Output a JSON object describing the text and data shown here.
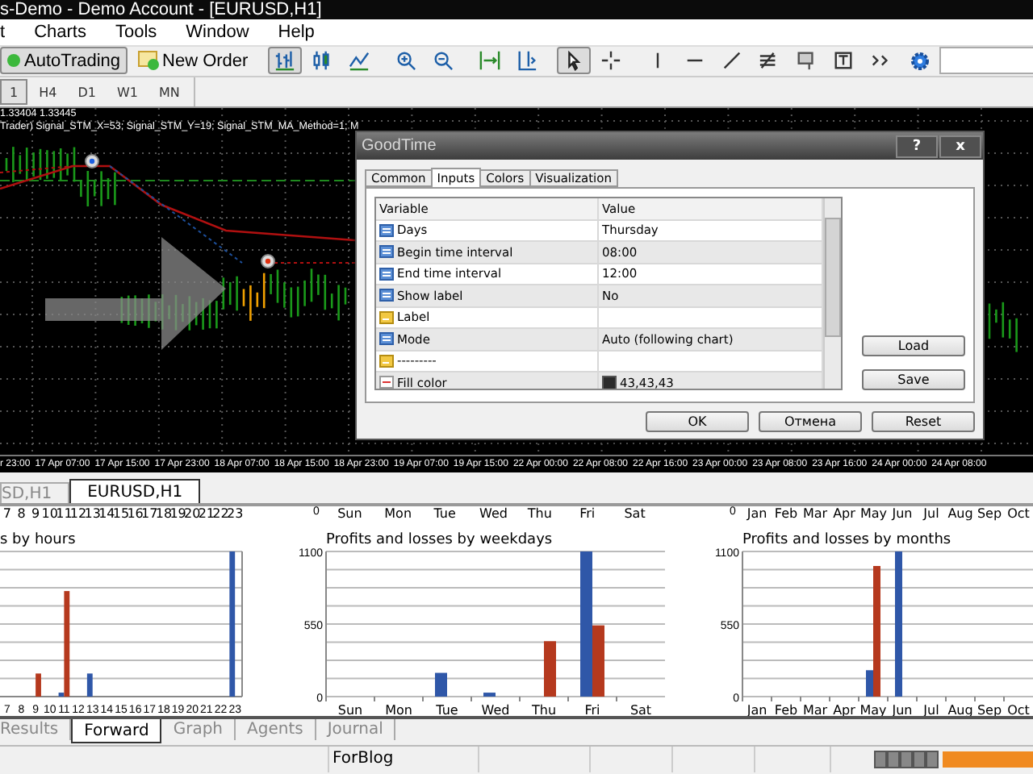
{
  "window": {
    "title": "s-Demo - Demo Account - [EURUSD,H1]"
  },
  "menu": [
    "t",
    "Charts",
    "Tools",
    "Window",
    "Help"
  ],
  "toolbar": {
    "auto_trading": "AutoTrading",
    "new_order": "New Order",
    "tools": [
      {
        "kind": "bars",
        "selected": true
      },
      {
        "kind": "candles",
        "selected": false
      },
      {
        "kind": "line",
        "selected": false
      },
      {
        "kind": "zoom-in",
        "selected": false
      },
      {
        "kind": "zoom-out",
        "selected": false
      },
      {
        "kind": "scroll",
        "selected": false
      },
      {
        "kind": "shift",
        "selected": false
      },
      {
        "kind": "cursor",
        "selected": true
      },
      {
        "kind": "crosshair",
        "selected": false
      },
      {
        "kind": "vline",
        "selected": false
      },
      {
        "kind": "hline",
        "selected": false
      },
      {
        "kind": "trend",
        "selected": false
      },
      {
        "kind": "fibo",
        "selected": false
      },
      {
        "kind": "label",
        "selected": false
      },
      {
        "kind": "text",
        "selected": false
      },
      {
        "kind": "arrows",
        "selected": false
      }
    ]
  },
  "timeframes": [
    {
      "label": "1",
      "selected": true
    },
    {
      "label": "H4",
      "selected": false
    },
    {
      "label": "D1",
      "selected": false
    },
    {
      "label": "W1",
      "selected": false
    },
    {
      "label": "MN",
      "selected": false
    }
  ],
  "chart": {
    "prices": "1.33404 1.33445",
    "indicator": "Trader) Signal_STM_X=53; Signal_STM_Y=19; Signal_STM_MA_Method=1; M",
    "time_labels": [
      "r 23:00",
      "17 Apr 07:00",
      "17 Apr 15:00",
      "17 Apr 23:00",
      "18 Apr 07:00",
      "18 Apr 15:00",
      "18 Apr 23:00",
      "19 Apr 07:00",
      "19 Apr 15:00",
      "22 Apr 00:00",
      "22 Apr 08:00",
      "22 Apr 16:00",
      "23 Apr 00:00",
      "23 Apr 08:00",
      "23 Apr 16:00",
      "24 Apr 00:00",
      "24 Apr 08:00"
    ]
  },
  "dialog": {
    "title": "GoodTime",
    "help": "?",
    "close": "x",
    "tabs": [
      {
        "label": "Common",
        "selected": false
      },
      {
        "label": "Inputs",
        "selected": true
      },
      {
        "label": "Colors",
        "selected": false
      },
      {
        "label": "Visualization",
        "selected": false
      }
    ],
    "columns": [
      "Variable",
      "Value"
    ],
    "rows": [
      {
        "kind": "number",
        "variable": "Days",
        "value": "Thursday"
      },
      {
        "kind": "number",
        "variable": "Begin time interval",
        "value": "08:00"
      },
      {
        "kind": "number",
        "variable": "End time interval",
        "value": "12:00"
      },
      {
        "kind": "number",
        "variable": "Show label",
        "value": "No"
      },
      {
        "kind": "text",
        "variable": "Label"
      },
      {
        "kind": "number",
        "variable": "Mode",
        "value": "Auto (following chart)"
      },
      {
        "kind": "text",
        "variable": "---------"
      },
      {
        "kind": "color",
        "variable": "Fill color",
        "value": "43,43,43",
        "color": "#2b2b2b"
      }
    ],
    "side_buttons": [
      "Load",
      "Save"
    ],
    "buttons": [
      "OK",
      "Отмена",
      "Reset"
    ]
  },
  "chart_tabs": [
    {
      "label": "SD,H1",
      "selected": false
    },
    {
      "label": "EURUSD,H1",
      "selected": true
    }
  ],
  "report": {
    "hours": {
      "upper_labels": [
        "7",
        "8",
        "9",
        "10",
        "11",
        "12",
        "13",
        "14",
        "15",
        "16",
        "17",
        "18",
        "19",
        "20",
        "21",
        "22",
        "23"
      ],
      "title": "s by hours",
      "x_labels": [
        "7",
        "8",
        "9",
        "10",
        "11",
        "12",
        "13",
        "14",
        "15",
        "16",
        "17",
        "18",
        "19",
        "20",
        "21",
        "22",
        "23"
      ]
    },
    "weekdays": {
      "upper_zero": "0",
      "upper_labels": [
        "Sun",
        "Mon",
        "Tue",
        "Wed",
        "Thu",
        "Fri",
        "Sat"
      ],
      "chart_data": {
        "type": "bar",
        "title": "Profits and losses by weekdays",
        "categories": [
          "Sun",
          "Mon",
          "Tue",
          "Wed",
          "Thu",
          "Fri",
          "Sat"
        ],
        "series": [
          {
            "color": "#2f57a8",
            "values": [
              null,
              null,
              180,
              30,
              null,
              1100,
              null
            ]
          },
          {
            "color": "#b5391e",
            "values": [
              null,
              null,
              null,
              null,
              420,
              540,
              null
            ]
          }
        ],
        "ylim": [
          0,
          1100
        ],
        "yticks": [
          0,
          550,
          1100
        ]
      }
    },
    "months": {
      "upper_zero": "0",
      "upper_labels": [
        "Jan",
        "Feb",
        "Mar",
        "Apr",
        "May",
        "Jun",
        "Jul",
        "Aug",
        "Sep",
        "Oct"
      ],
      "chart_data": {
        "type": "bar",
        "title": "Profits and losses by months",
        "categories": [
          "Jan",
          "Feb",
          "Mar",
          "Apr",
          "May",
          "Jun",
          "Jul",
          "Aug",
          "Sep",
          "Oct"
        ],
        "series": [
          {
            "color": "#2f57a8",
            "values": [
              null,
              null,
              null,
              null,
              200,
              1100,
              null,
              null,
              null,
              null
            ]
          },
          {
            "color": "#b5391e",
            "values": [
              null,
              null,
              null,
              null,
              990,
              null,
              null,
              null,
              null,
              null
            ]
          }
        ],
        "ylim": [
          0,
          1100
        ],
        "yticks": [
          0,
          550,
          1100
        ]
      }
    }
  },
  "bottom_tabs": [
    {
      "label": "Results",
      "selected": false
    },
    {
      "label": "Forward",
      "selected": true
    },
    {
      "label": "Graph",
      "selected": false
    },
    {
      "label": "Agents",
      "selected": false
    },
    {
      "label": "Journal",
      "selected": false
    }
  ],
  "status_bar": {
    "text": "ForBlog"
  }
}
